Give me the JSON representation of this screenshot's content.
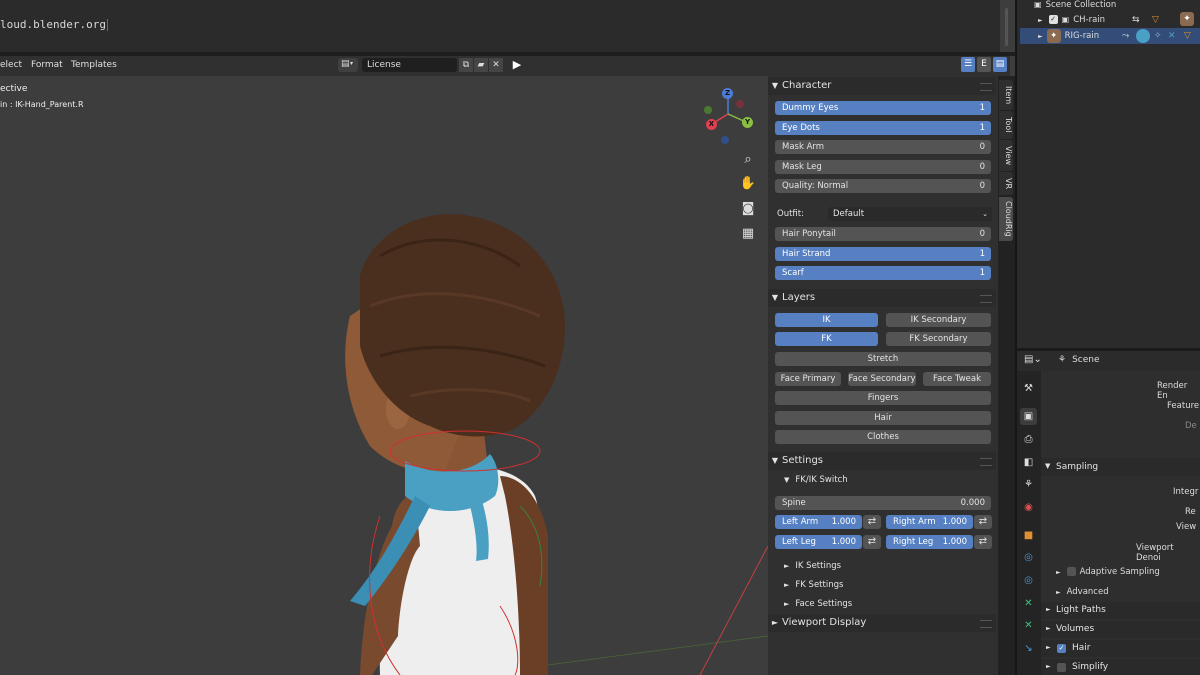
{
  "text_editor": {
    "text": "loud.blender.org"
  },
  "header": {
    "menus": [
      "elect",
      "Format",
      "Templates"
    ],
    "text_block_name": "License"
  },
  "viewport": {
    "title": "ective",
    "subtitle": "in : IK-Hand_Parent.R",
    "gizmo": {
      "x": "X",
      "y": "Y",
      "z": "Z"
    }
  },
  "npanel": {
    "tabs": [
      "Item",
      "Tool",
      "View",
      "VR",
      "CloudRig"
    ],
    "character": {
      "title": "Character",
      "rows": [
        {
          "label": "Dummy Eyes",
          "value": "1",
          "on": true
        },
        {
          "label": "Eye Dots",
          "value": "1",
          "on": true
        },
        {
          "label": "Mask Arm",
          "value": "0",
          "on": false
        },
        {
          "label": "Mask Leg",
          "value": "0",
          "on": false
        },
        {
          "label": "Quality: Normal",
          "value": "0",
          "on": false
        }
      ],
      "outfit_label": "Outfit:",
      "outfit_value": "Default",
      "outfit_rows": [
        {
          "label": "Hair Ponytail",
          "value": "0",
          "on": false
        },
        {
          "label": "Hair Strand",
          "value": "1",
          "on": true
        },
        {
          "label": "Scarf",
          "value": "1",
          "on": true
        }
      ]
    },
    "layers": {
      "title": "Layers",
      "ik": "IK",
      "ik_secondary": "IK Secondary",
      "fk": "FK",
      "fk_secondary": "FK Secondary",
      "stretch": "Stretch",
      "face_primary": "Face Primary",
      "face_secondary": "Face Secondary",
      "face_tweak": "Face Tweak",
      "fingers": "Fingers",
      "hair": "Hair",
      "clothes": "Clothes"
    },
    "settings": {
      "title": "Settings",
      "fkik_switch": "FK/IK Switch",
      "spine_label": "Spine",
      "spine_value": "0.000",
      "left_arm_label": "Left Arm",
      "left_arm_value": "1.000",
      "right_arm_label": "Right Arm",
      "right_arm_value": "1.000",
      "left_leg_label": "Left Leg",
      "left_leg_value": "1.000",
      "right_leg_label": "Right Leg",
      "right_leg_value": "1.000",
      "ik_settings": "IK Settings",
      "fk_settings": "FK Settings",
      "face_settings": "Face Settings"
    },
    "viewport_display": "Viewport Display"
  },
  "outliner": {
    "scene_collection": "Scene Collection",
    "items": [
      "CH-rain",
      "RIG-rain"
    ]
  },
  "properties": {
    "scene_label": "Scene",
    "render_engine": "Render En",
    "feature_set": "Feature",
    "device": "De",
    "sampling": "Sampling",
    "integrator": "Integr",
    "render": "Re",
    "viewport": "View",
    "viewport_denoise": "Viewport Denoi",
    "adaptive_sampling": "Adaptive Sampling",
    "advanced": "Advanced",
    "light_paths": "Light Paths",
    "volumes": "Volumes",
    "hair": "Hair",
    "simplify": "Simplify"
  },
  "colors": {
    "accent": "#5680c2",
    "bg": "#3d3d3d",
    "panel": "#303030"
  }
}
